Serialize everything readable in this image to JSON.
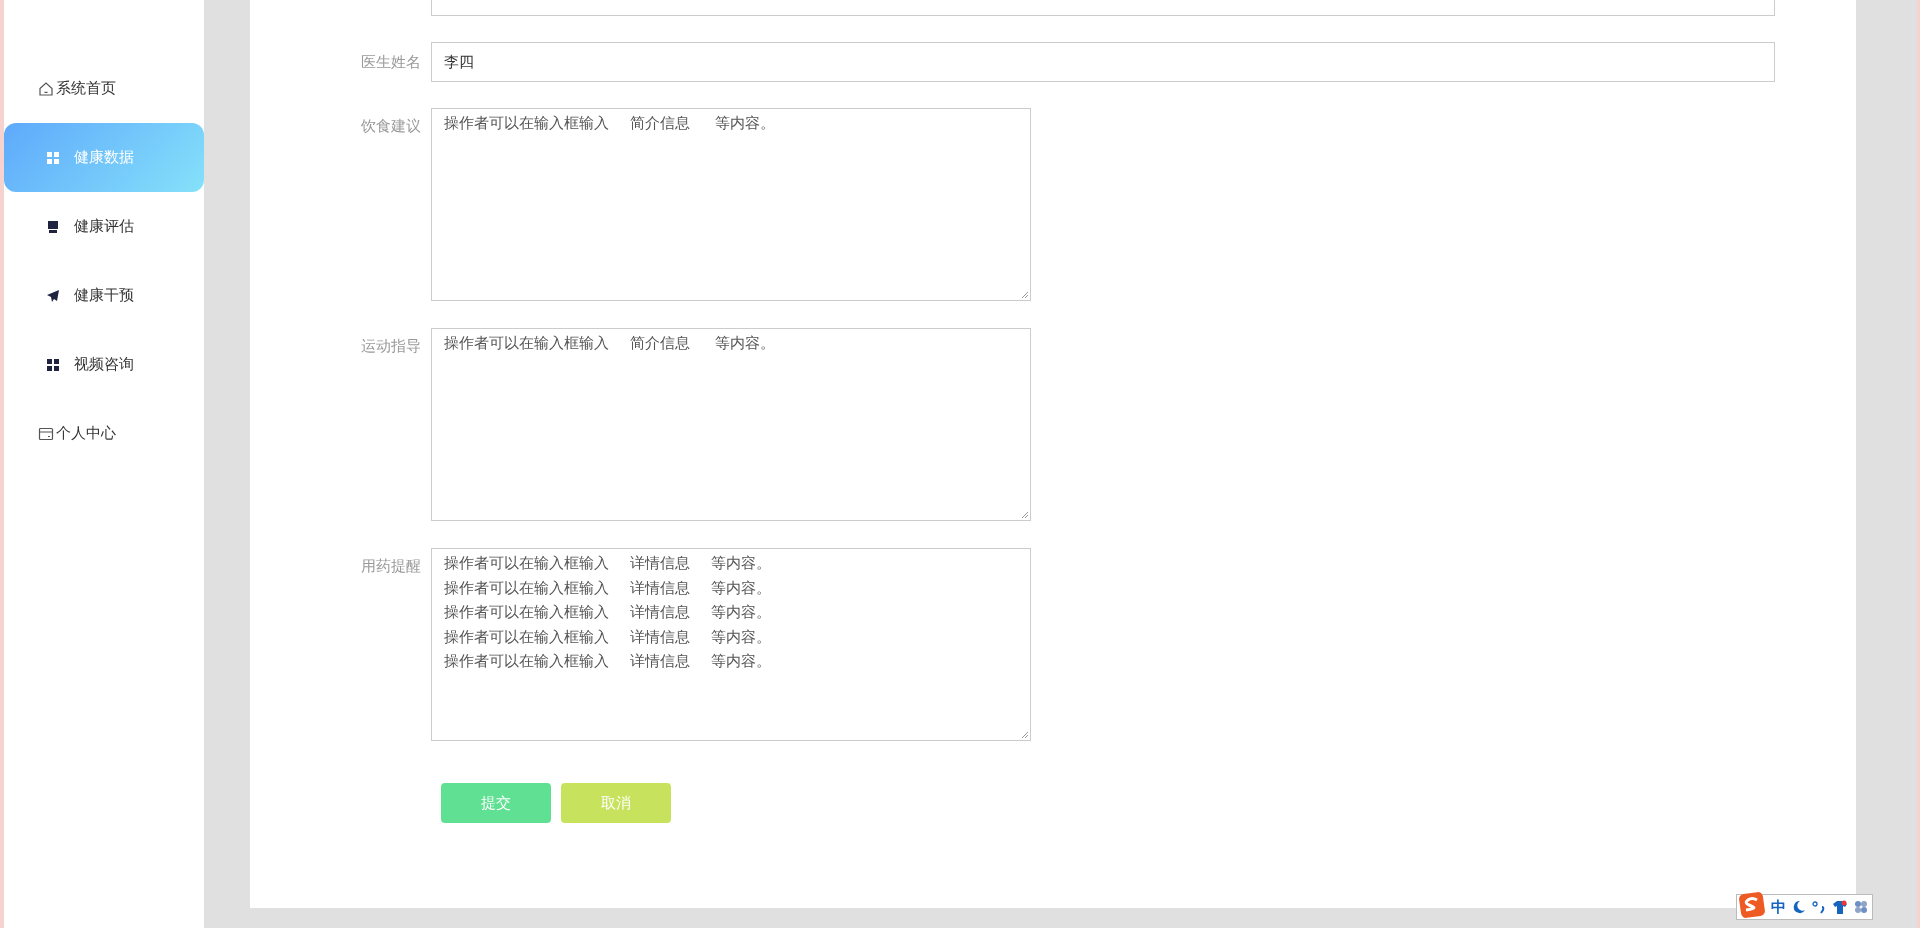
{
  "sidebar": {
    "items": [
      {
        "label": "系统首页",
        "kind": "link",
        "selected": false
      },
      {
        "label": "健康数据",
        "kind": "menu",
        "selected": true
      },
      {
        "label": "健康评估",
        "kind": "menu",
        "selected": false
      },
      {
        "label": "健康干预",
        "kind": "menu",
        "selected": false
      },
      {
        "label": "视频咨询",
        "kind": "menu",
        "selected": false
      },
      {
        "label": "个人中心",
        "kind": "link",
        "selected": false
      }
    ]
  },
  "form": {
    "fields": [
      {
        "kind": "input"
      },
      {
        "kind": "input",
        "label": "医生姓名",
        "value": "李四"
      },
      {
        "kind": "textarea",
        "label": "饮食建议",
        "lines": [
          "操作者可以在输入框输入     简介信息      等内容。"
        ]
      },
      {
        "kind": "textarea",
        "label": "运动指导",
        "lines": [
          "操作者可以在输入框输入     简介信息      等内容。"
        ]
      },
      {
        "kind": "textarea",
        "label": "用药提醒",
        "lines": [
          "操作者可以在输入框输入     详情信息     等内容。",
          "操作者可以在输入框输入     详情信息     等内容。",
          "操作者可以在输入框输入     详情信息     等内容。",
          "操作者可以在输入框输入     详情信息     等内容。",
          "操作者可以在输入框输入     详情信息     等内容。"
        ]
      }
    ],
    "buttons": [
      {
        "label": "提交",
        "kind": "primary"
      },
      {
        "label": "取消",
        "kind": "secondary"
      }
    ]
  },
  "ime_toolbar": {
    "mode": "中"
  }
}
